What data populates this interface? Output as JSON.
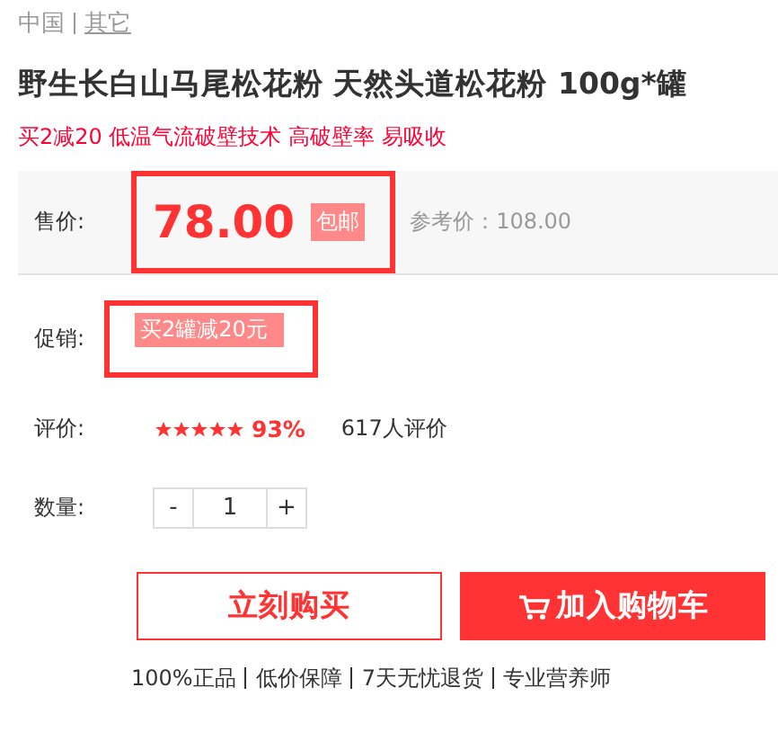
{
  "breadcrumb": [
    {
      "label": "中国",
      "link": false
    },
    {
      "label": "其它",
      "link": true
    }
  ],
  "title": "野生长白山马尾松花粉 天然头道松花粉 100g*罐",
  "subtitle": "买2减20 低温气流破壁技术 高破壁率 易吸收",
  "price": {
    "label": "售价:",
    "value": "78.00",
    "badge": "包邮",
    "reference": "参考价：108.00",
    "highlighted": true
  },
  "promotion": {
    "label": "促销:",
    "tag": "买2罐减20元",
    "highlighted": true
  },
  "rating": {
    "label": "评价:",
    "stars": 5,
    "percent": "93%",
    "reviews": "617人评价"
  },
  "quantity": {
    "label": "数量:",
    "minus": "-",
    "value": "1",
    "plus": "+"
  },
  "buttons": [
    {
      "kind": "outline",
      "label": "立刻购买"
    },
    {
      "kind": "cart",
      "label": "加入购物车"
    }
  ],
  "guarantees": [
    "100%正品",
    "低价保障",
    "7天无忧退货",
    "专业营养师"
  ]
}
